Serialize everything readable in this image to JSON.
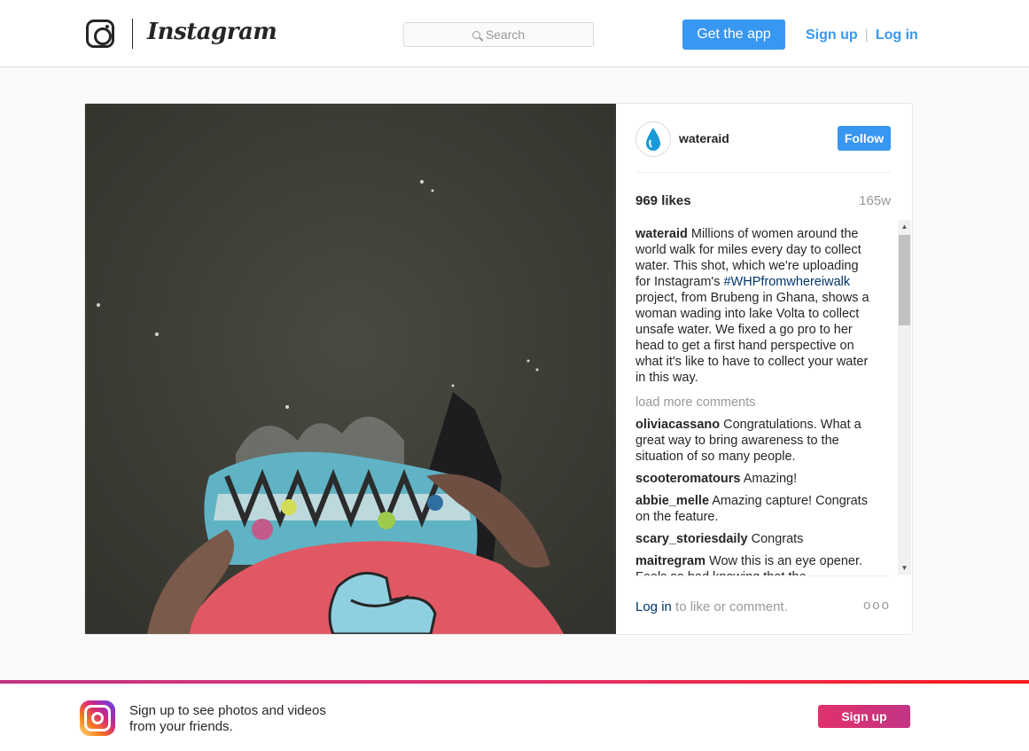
{
  "header": {
    "brand": "Instagram",
    "search_placeholder": "Search",
    "get_app_label": "Get the app",
    "signup_label": "Sign up",
    "separator": "|",
    "login_label": "Log in"
  },
  "post": {
    "username": "wateraid",
    "follow_label": "Follow",
    "likes": "969 likes",
    "age": "165w",
    "caption": {
      "user": "wateraid",
      "text_before": "Millions of women around the world walk for miles every day to collect water. This shot, which we're uploading for Instagram's",
      "hashtag": "#WHPfromwhereiwalk",
      "text_after": "project, from Brubeng in Ghana, shows a woman wading into lake Volta to collect unsafe water. We fixed a go pro to her head to get a first hand perspective on what it's like to have to collect your water in this way."
    },
    "load_more_label": "load more comments",
    "comments": [
      {
        "user": "oliviacassano",
        "text": "Congratulations. What a great way to bring awareness to the situation of so many people."
      },
      {
        "user": "scooteromatours",
        "text": "Amazing!"
      },
      {
        "user": "abbie_melle",
        "text": "Amazing capture! Congrats on the feature."
      },
      {
        "user": "scary_storiesdaily",
        "text": "Congrats"
      },
      {
        "user": "maitregram",
        "text": "Wow this is an eye opener. Feels so bad knowing that the..."
      }
    ],
    "login_link": "Log in",
    "login_suffix": "to like or comment.",
    "more_label": "ooo"
  },
  "banner": {
    "text": "Sign up to see photos and videos from your friends.",
    "signup_label": "Sign up"
  },
  "colors": {
    "accent": "#3897f0",
    "hashtag": "#003569",
    "brand_gradient": [
      "#e1306c",
      "#c13584"
    ]
  }
}
